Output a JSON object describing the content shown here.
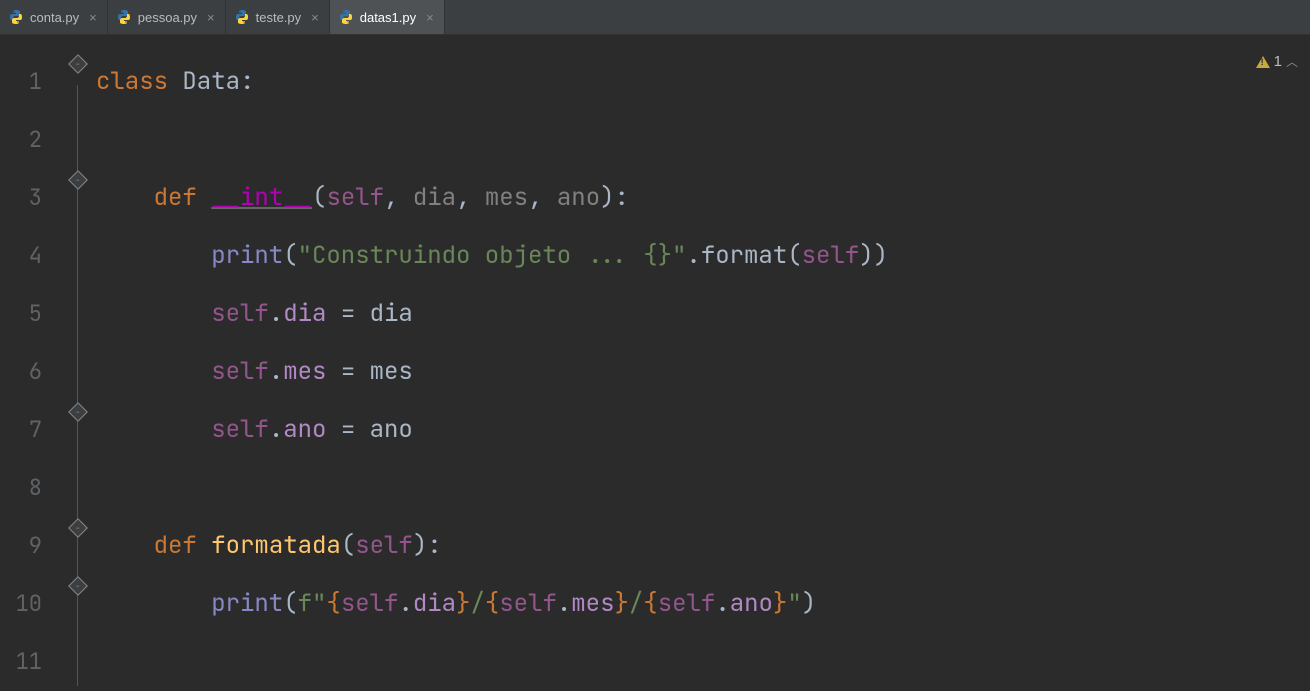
{
  "tabs": [
    {
      "label": "conta.py",
      "active": false
    },
    {
      "label": "pessoa.py",
      "active": false
    },
    {
      "label": "teste.py",
      "active": false
    },
    {
      "label": "datas1.py",
      "active": true
    }
  ],
  "warning_count": "1",
  "code": {
    "class_kw": "class",
    "class_name": "Data",
    "colon": ":",
    "def_kw": "def",
    "init_name": "__int__",
    "init_params": {
      "self": "self",
      "p1": "dia",
      "p2": "mes",
      "p3": "ano"
    },
    "print_name": "print",
    "print_str": "\"Construindo objeto ... {}\"",
    "format_name": "format",
    "assign1_lhs_self": "self",
    "assign1_lhs_field": "dia",
    "assign1_eq": " = ",
    "assign1_rhs": "dia",
    "assign2_lhs_self": "self",
    "assign2_lhs_field": "mes",
    "assign2_eq": " = ",
    "assign2_rhs": "mes",
    "assign3_lhs_self": "self",
    "assign3_lhs_field": "ano",
    "assign3_eq": " = ",
    "assign3_rhs": "ano",
    "method2_name": "formatada",
    "method2_param": "self",
    "fstr_prefix": "f",
    "fstr_q1": "\"",
    "fstr_lb": "{",
    "fstr_rb": "}",
    "fstr_self": "self",
    "fstr_dot": ".",
    "fstr_f1": "dia",
    "fstr_slash": "/",
    "fstr_f2": "mes",
    "fstr_f3": "ano",
    "fstr_q2": "\""
  },
  "line_numbers": [
    "1",
    "2",
    "3",
    "4",
    "5",
    "6",
    "7",
    "8",
    "9",
    "10",
    "11"
  ]
}
